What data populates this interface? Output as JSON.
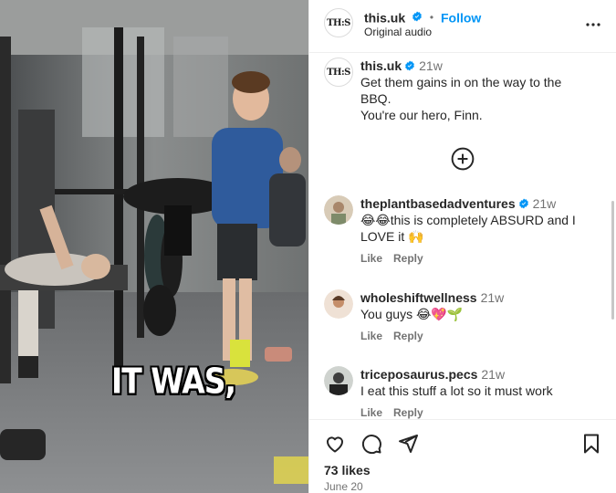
{
  "header": {
    "avatar_text": "TH:S",
    "username": "this.uk",
    "separator": "•",
    "follow_label": "Follow",
    "subtitle": "Original audio"
  },
  "caption": {
    "avatar_text": "TH:S",
    "username": "this.uk",
    "age": "21w",
    "lines": [
      "Get them gains in on the way to the BBQ.",
      "You're our hero, Finn."
    ]
  },
  "comments": [
    {
      "username": "theplantbasedadventures",
      "verified": true,
      "age": "21w",
      "text": "this is completely ABSURD and I LOVE it",
      "emoji_before": "😂😂",
      "emoji_after": "🙌",
      "like_label": "Like",
      "reply_label": "Reply"
    },
    {
      "username": "wholeshiftwellness",
      "verified": false,
      "age": "21w",
      "text": "You guys",
      "emoji_after": "😂💖🌱",
      "like_label": "Like",
      "reply_label": "Reply"
    },
    {
      "username": "triceposaurus.pecs",
      "verified": false,
      "age": "21w",
      "text": "I eat this stuff a lot so it must work",
      "like_label": "Like",
      "reply_label": "Reply"
    }
  ],
  "media": {
    "overlay_text": "IT WAS,"
  },
  "footer": {
    "likes": "73 likes",
    "date": "June 20"
  },
  "colors": {
    "accent": "#0095f6",
    "verified": "#0095f6",
    "muted": "#737373",
    "text": "#262626"
  }
}
